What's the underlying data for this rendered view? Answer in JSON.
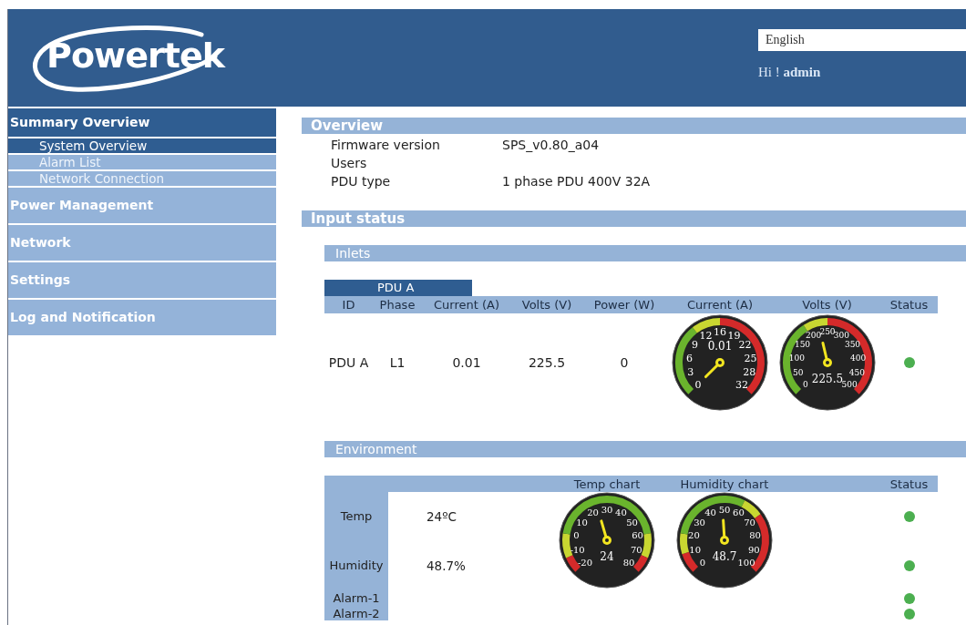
{
  "header": {
    "logo": "Powertek",
    "language": "English",
    "greeting": "Hi ! **admin**"
  },
  "sidebar": [
    {
      "label": "Summary Overview",
      "selected": true,
      "children": [
        {
          "label": "System Overview",
          "selected": true
        },
        {
          "label": "Alarm List",
          "selected": false
        },
        {
          "label": "Network Connection",
          "selected": false
        }
      ]
    },
    {
      "label": "Power Management",
      "selected": false
    },
    {
      "label": "Network",
      "selected": false
    },
    {
      "label": "Settings",
      "selected": false
    },
    {
      "label": "Log and Notification",
      "selected": false
    }
  ],
  "overview": {
    "title": "Overview",
    "rows": [
      {
        "label": "Firmware version",
        "value": "SPS_v0.80_a04"
      },
      {
        "label": "Users"
      },
      {
        "label": "PDU type",
        "value": "1 phase PDU 400V 32A"
      }
    ]
  },
  "input_status": {
    "title": "Input status",
    "inlets": {
      "title": "Inlets",
      "group": "PDU A",
      "columns": [
        "ID",
        "Phase",
        "Current (A)",
        "Volts (V)",
        "Power (W)",
        "Current (A)",
        "Volts (V)",
        "Status"
      ],
      "rows": [
        {
          "id": "PDU A",
          "phase": "L1",
          "current": "0.01",
          "volts": "225.5",
          "power": "0",
          "color": "#4caf50",
          "gauges": [
            {
              "kind": "current",
              "left_ticks": [
                "12",
                "9",
                "6",
                "3",
                "0"
              ],
              "right_ticks": [
                "16",
                "19",
                "22",
                "25",
                "28",
                "32"
              ],
              "reading": "0.01"
            },
            {
              "kind": "volts",
              "left_ticks": [
                "200",
                "150",
                "100",
                "50",
                "0"
              ],
              "right_ticks": [
                "250",
                "300",
                "350",
                "400",
                "450",
                "500"
              ],
              "reading": "225.5"
            }
          ]
        }
      ]
    }
  },
  "environment": {
    "title": "Environment",
    "columns": [
      "Temp chart",
      "Humidity chart",
      "Status"
    ],
    "gauges": [
      {
        "kind": "temp",
        "left_ticks": [
          "20",
          "10",
          "0",
          "-10",
          "-20"
        ],
        "right_ticks": [
          "30",
          "40",
          "50",
          "60",
          "70",
          "80"
        ],
        "reading": "24"
      },
      {
        "kind": "humidity",
        "left_ticks": [
          "40",
          "30",
          "20",
          "10",
          "0"
        ],
        "right_ticks": [
          "50",
          "60",
          "70",
          "80",
          "90",
          "100"
        ],
        "reading": "48.7"
      }
    ],
    "rows": [
      {
        "label": "Temp",
        "value": "24ºC",
        "color": "#4caf50"
      },
      {
        "label": "Humidity",
        "value": "48.7%",
        "color": "#4caf50"
      },
      {
        "label": "Alarm-1",
        "color": "#4caf50"
      },
      {
        "label": "Alarm-2",
        "color": "#4caf50"
      }
    ]
  }
}
